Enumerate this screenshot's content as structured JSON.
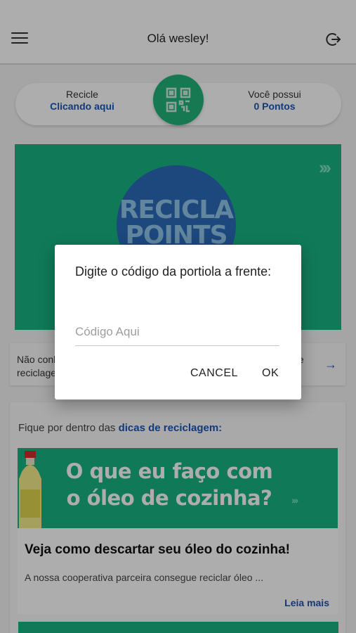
{
  "header": {
    "greeting": "Olá wesley!",
    "menu_icon": "hamburger-menu-icon",
    "logout_icon": "logout-icon"
  },
  "recycle_bar": {
    "left_label": "Recicle",
    "left_link": "Clicando aqui",
    "right_label": "Você possui",
    "right_points": "0 Pontos",
    "qr_icon": "qr-code-icon"
  },
  "banner": {
    "line1": "RECICLA",
    "line2": "POINTS",
    "chevrons": "›››"
  },
  "info_card": {
    "text": "Não conhece os pontos de coleta? Clique aqui e veja os locais de reciclagem"
  },
  "tips": {
    "heading_prefix": "Fique por dentro das ",
    "heading_link": "dicas de reciclagem:",
    "card": {
      "image_text": "O que eu faço com o óleo de cozinha?",
      "title": "Veja como descartar seu óleo do cozinha!",
      "description": "A nossa cooperativa parceira consegue reciclar óleo ...",
      "more_link": "Leia mais"
    }
  },
  "dialog": {
    "title": "Digite o código da portiola a frente:",
    "input_placeholder": "Código Aqui",
    "input_value": "",
    "cancel_label": "CANCEL",
    "ok_label": "OK"
  },
  "colors": {
    "accent_green": "#18b482",
    "link_blue": "#1a56b8",
    "circle_blue": "#2c6ab8"
  }
}
